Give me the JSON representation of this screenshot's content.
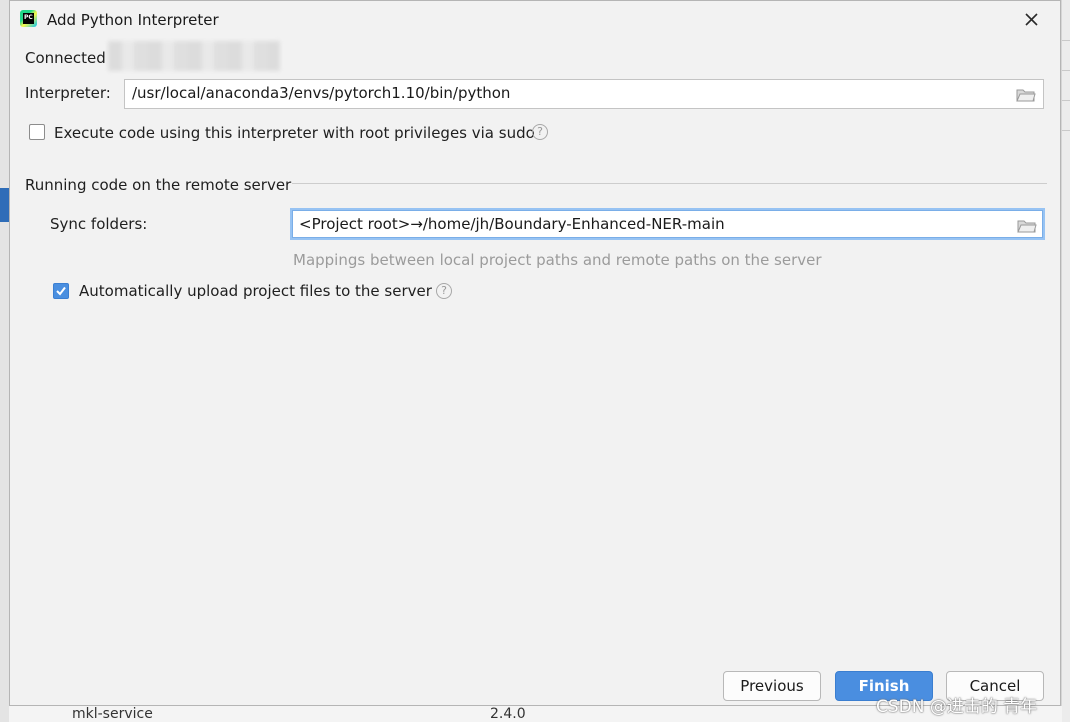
{
  "window": {
    "title": "Add Python Interpreter",
    "app_icon": "pycharm-icon",
    "close": "close-icon"
  },
  "connection": {
    "label": "Connected"
  },
  "interpreter": {
    "label": "Interpreter:",
    "value": "/usr/local/anaconda3/envs/pytorch1.10/bin/python",
    "browse_icon": "folder-icon"
  },
  "sudo": {
    "label": "Execute code using this interpreter with root privileges via sudo",
    "checked": false,
    "help_icon": "question-icon",
    "help_glyph": "?"
  },
  "remote_section": {
    "header": "Running code on the remote server",
    "sync_label": "Sync folders:",
    "sync_value": "<Project root>→/home/jh/Boundary-Enhanced-NER-main",
    "sync_hint": "Mappings between local project paths and remote paths on the server",
    "auto_upload_label": "Automatically upload project files to the server",
    "auto_upload_checked": true
  },
  "buttons": {
    "previous": "Previous",
    "finish": "Finish",
    "cancel": "Cancel"
  },
  "background": {
    "package_name": "mkl-service",
    "package_version": "2.4.0"
  },
  "watermark": "CSDN @进击的 青年",
  "colors": {
    "accent": "#4a8ee0",
    "focus_border": "#97c3f3",
    "dialog_bg": "#f2f2f2"
  }
}
